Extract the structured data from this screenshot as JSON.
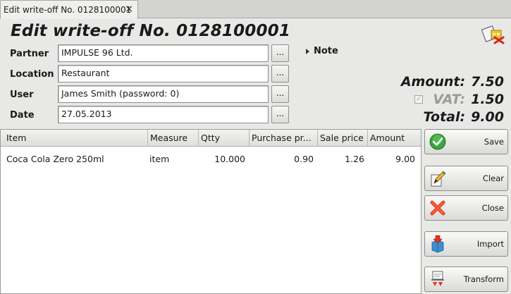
{
  "tab": {
    "label": "Edit write-off No. 0128100001",
    "close": "×"
  },
  "header": {
    "title": "Edit write-off No. 0128100001"
  },
  "form": {
    "partner": {
      "label": "Partner",
      "value": "IMPULSE 96 Ltd."
    },
    "location": {
      "label": "Location",
      "value": "Restaurant"
    },
    "user": {
      "label": "User",
      "value": "James Smith (password: 0)"
    },
    "date": {
      "label": "Date",
      "value": "27.05.2013"
    },
    "picker_label": "..."
  },
  "note": {
    "label": "Note"
  },
  "totals": {
    "amount_label": "Amount:",
    "amount_value": "7.50",
    "vat_label": "VAT:",
    "vat_value": "1.50",
    "vat_checked": true,
    "total_label": "Total:",
    "total_value": "9.00"
  },
  "table": {
    "columns": [
      "Item",
      "Measure",
      "Qtty",
      "Purchase pr...",
      "Sale price",
      "Amount"
    ],
    "rows": [
      [
        "Coca Cola Zero 250ml",
        "item",
        "10.000",
        "0.90",
        "1.26",
        "9.00"
      ]
    ]
  },
  "actions": {
    "save": {
      "label": "Save",
      "icon": "check-icon"
    },
    "clear": {
      "label": "Clear",
      "icon": "clear-pencil-icon"
    },
    "close": {
      "label": "Close",
      "icon": "close-x-icon"
    },
    "import": {
      "label": "Import",
      "icon": "import-icon"
    },
    "transform": {
      "label": "Transform",
      "icon": "transform-icon"
    }
  },
  "colors": {
    "save_green": "#3aa63a",
    "close_red": "#e8401e",
    "import_blue": "#3b8fd0"
  }
}
